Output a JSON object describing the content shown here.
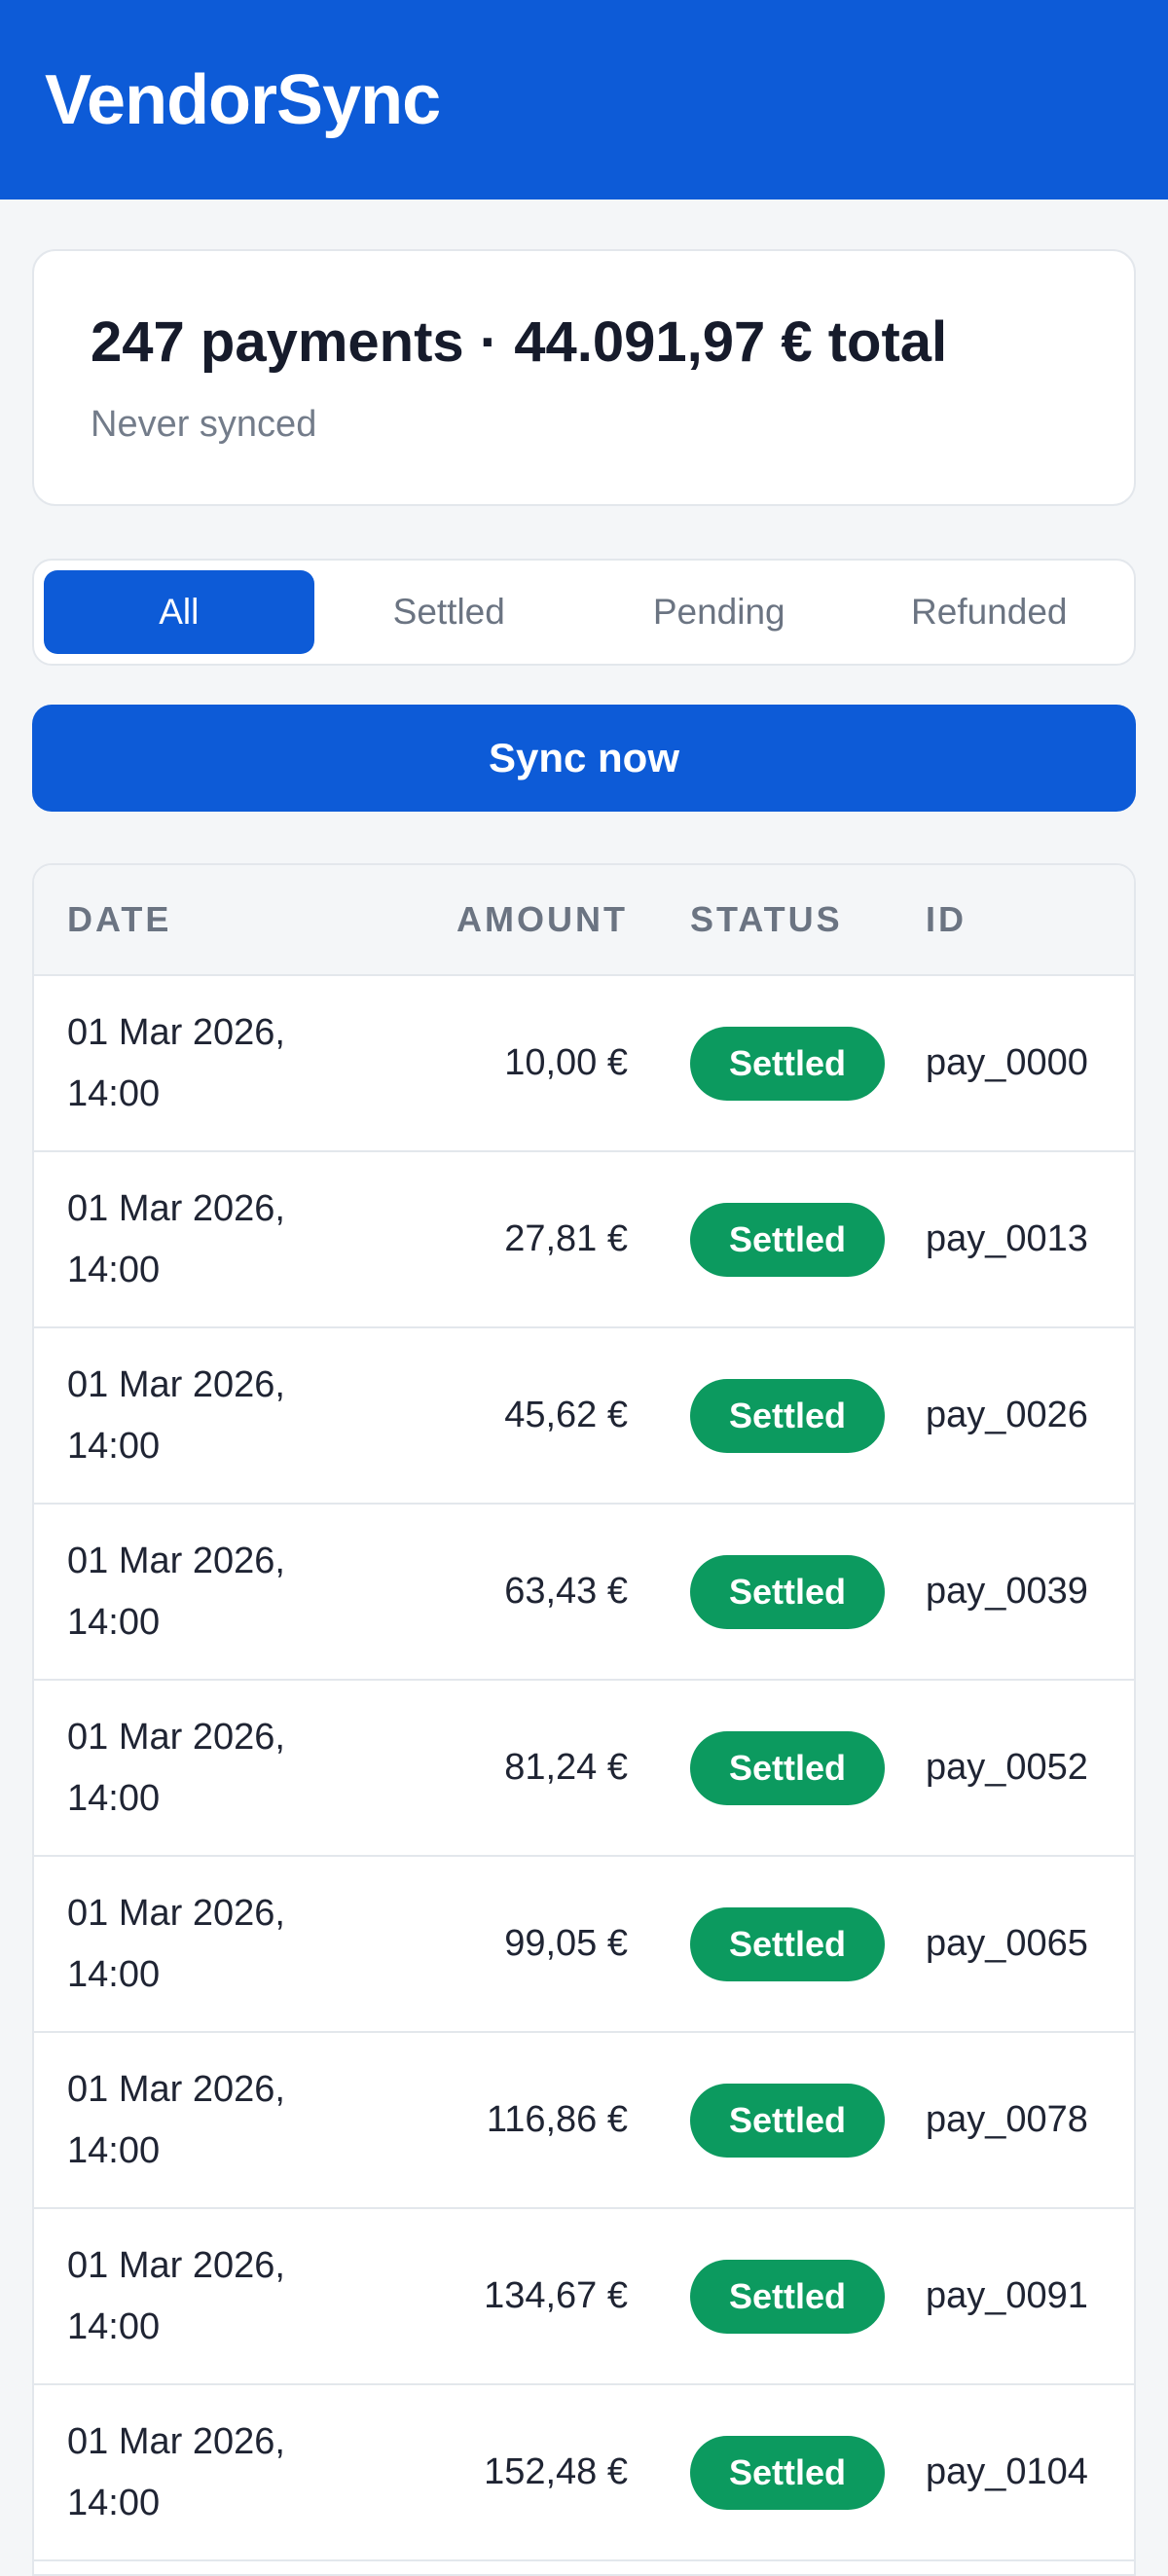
{
  "app": {
    "title": "VendorSync"
  },
  "summary": {
    "title": "247 payments · 44.091,97 € total",
    "subtitle": "Never synced"
  },
  "filters": {
    "tabs": [
      {
        "label": "All",
        "active": true
      },
      {
        "label": "Settled",
        "active": false
      },
      {
        "label": "Pending",
        "active": false
      },
      {
        "label": "Refunded",
        "active": false
      }
    ]
  },
  "actions": {
    "sync_label": "Sync now"
  },
  "colors": {
    "brand": "#0d5bd7",
    "settled_badge": "#0c9a5f"
  },
  "table": {
    "headers": {
      "date": "DATE",
      "amount": "AMOUNT",
      "status": "STATUS",
      "id": "ID"
    },
    "rows": [
      {
        "date_line1": "01 Mar 2026,",
        "date_line2": "14:00",
        "amount": "10,00 €",
        "status": "Settled",
        "id": "pay_0000"
      },
      {
        "date_line1": "01 Mar 2026,",
        "date_line2": "14:00",
        "amount": "27,81 €",
        "status": "Settled",
        "id": "pay_0013"
      },
      {
        "date_line1": "01 Mar 2026,",
        "date_line2": "14:00",
        "amount": "45,62 €",
        "status": "Settled",
        "id": "pay_0026"
      },
      {
        "date_line1": "01 Mar 2026,",
        "date_line2": "14:00",
        "amount": "63,43 €",
        "status": "Settled",
        "id": "pay_0039"
      },
      {
        "date_line1": "01 Mar 2026,",
        "date_line2": "14:00",
        "amount": "81,24 €",
        "status": "Settled",
        "id": "pay_0052"
      },
      {
        "date_line1": "01 Mar 2026,",
        "date_line2": "14:00",
        "amount": "99,05 €",
        "status": "Settled",
        "id": "pay_0065"
      },
      {
        "date_line1": "01 Mar 2026,",
        "date_line2": "14:00",
        "amount": "116,86 €",
        "status": "Settled",
        "id": "pay_0078"
      },
      {
        "date_line1": "01 Mar 2026,",
        "date_line2": "14:00",
        "amount": "134,67 €",
        "status": "Settled",
        "id": "pay_0091"
      },
      {
        "date_line1": "01 Mar 2026,",
        "date_line2": "14:00",
        "amount": "152,48 €",
        "status": "Settled",
        "id": "pay_0104"
      }
    ]
  }
}
